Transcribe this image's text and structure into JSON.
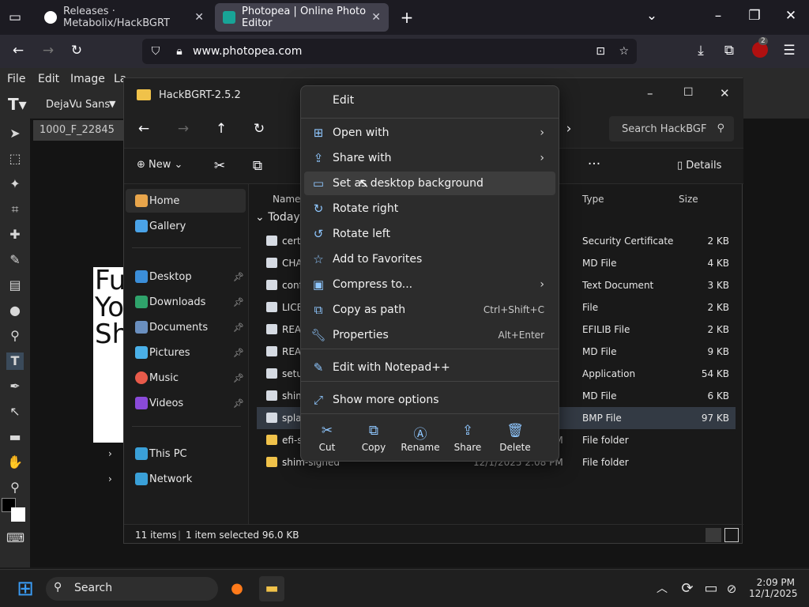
{
  "browser": {
    "tabs": [
      {
        "title": "Releases · Metabolix/HackBGRT",
        "active": false
      },
      {
        "title": "Photopea | Online Photo Editor",
        "active": true
      }
    ],
    "new_tab": "+",
    "url": "www.photopea.com",
    "badge_count": "2"
  },
  "photopea": {
    "menu": [
      "File",
      "Edit",
      "Image",
      "La"
    ],
    "font_name": "DejaVu Sans",
    "doc_tab": "1000_F_22845",
    "canvas_text": [
      "Fu",
      "Yo",
      "Sh"
    ]
  },
  "explorer": {
    "title": "HackBGRT-2.5.2",
    "search_placeholder": "Search HackBGF",
    "new_label": "New",
    "details_label": "Details",
    "sidebar": {
      "home": "Home",
      "gallery": "Gallery",
      "quick": [
        "Desktop",
        "Downloads",
        "Documents",
        "Pictures",
        "Music",
        "Videos"
      ],
      "this_pc": "This PC",
      "network": "Network"
    },
    "columns": {
      "name": "Name",
      "type": "Type",
      "size": "Size"
    },
    "group": "Today",
    "files": [
      {
        "name": "certi",
        "type": "Security Certificate",
        "size": "2 KB"
      },
      {
        "name": "CHA",
        "type": "MD File",
        "size": "4 KB"
      },
      {
        "name": "conf",
        "type": "Text Document",
        "size": "3 KB"
      },
      {
        "name": "LICE",
        "type": "File",
        "size": "2 KB"
      },
      {
        "name": "READ",
        "type": "EFILIB File",
        "size": "2 KB"
      },
      {
        "name": "READ",
        "type": "MD File",
        "size": "9 KB"
      },
      {
        "name": "setup",
        "type": "Application",
        "size": "54 KB"
      },
      {
        "name": "shim",
        "type": "MD File",
        "size": "6 KB"
      },
      {
        "name": "splas",
        "type": "BMP File",
        "size": "97 KB"
      },
      {
        "name": "efi-s",
        "type": "File folder",
        "size": ""
      },
      {
        "name": "shim-signed",
        "type": "File folder",
        "size": ""
      }
    ],
    "folder_date": "12/1/2025 2:08 PM",
    "status": {
      "count": "11 items",
      "selected": "1 item selected  96.0 KB"
    }
  },
  "context_menu": {
    "header": "Edit",
    "items": [
      {
        "label": "Open with",
        "shortcut": "",
        "submenu": true
      },
      {
        "label": "Share with",
        "shortcut": "",
        "submenu": true
      },
      {
        "label": "Set as desktop background",
        "shortcut": "",
        "submenu": false
      },
      {
        "label": "Rotate right",
        "shortcut": "",
        "submenu": false
      },
      {
        "label": "Rotate left",
        "shortcut": "",
        "submenu": false
      },
      {
        "label": "Add to Favorites",
        "shortcut": "",
        "submenu": false
      },
      {
        "label": "Compress to...",
        "shortcut": "",
        "submenu": true
      },
      {
        "label": "Copy as path",
        "shortcut": "Ctrl+Shift+C",
        "submenu": false
      },
      {
        "label": "Properties",
        "shortcut": "Alt+Enter",
        "submenu": false
      },
      {
        "label": "Edit with Notepad++",
        "shortcut": "",
        "submenu": false
      },
      {
        "label": "Show more options",
        "shortcut": "",
        "submenu": false
      }
    ],
    "quick_actions": [
      "Cut",
      "Copy",
      "Rename",
      "Share",
      "Delete"
    ]
  },
  "taskbar": {
    "search": "Search",
    "time": "2:09 PM",
    "date": "12/1/2025"
  }
}
